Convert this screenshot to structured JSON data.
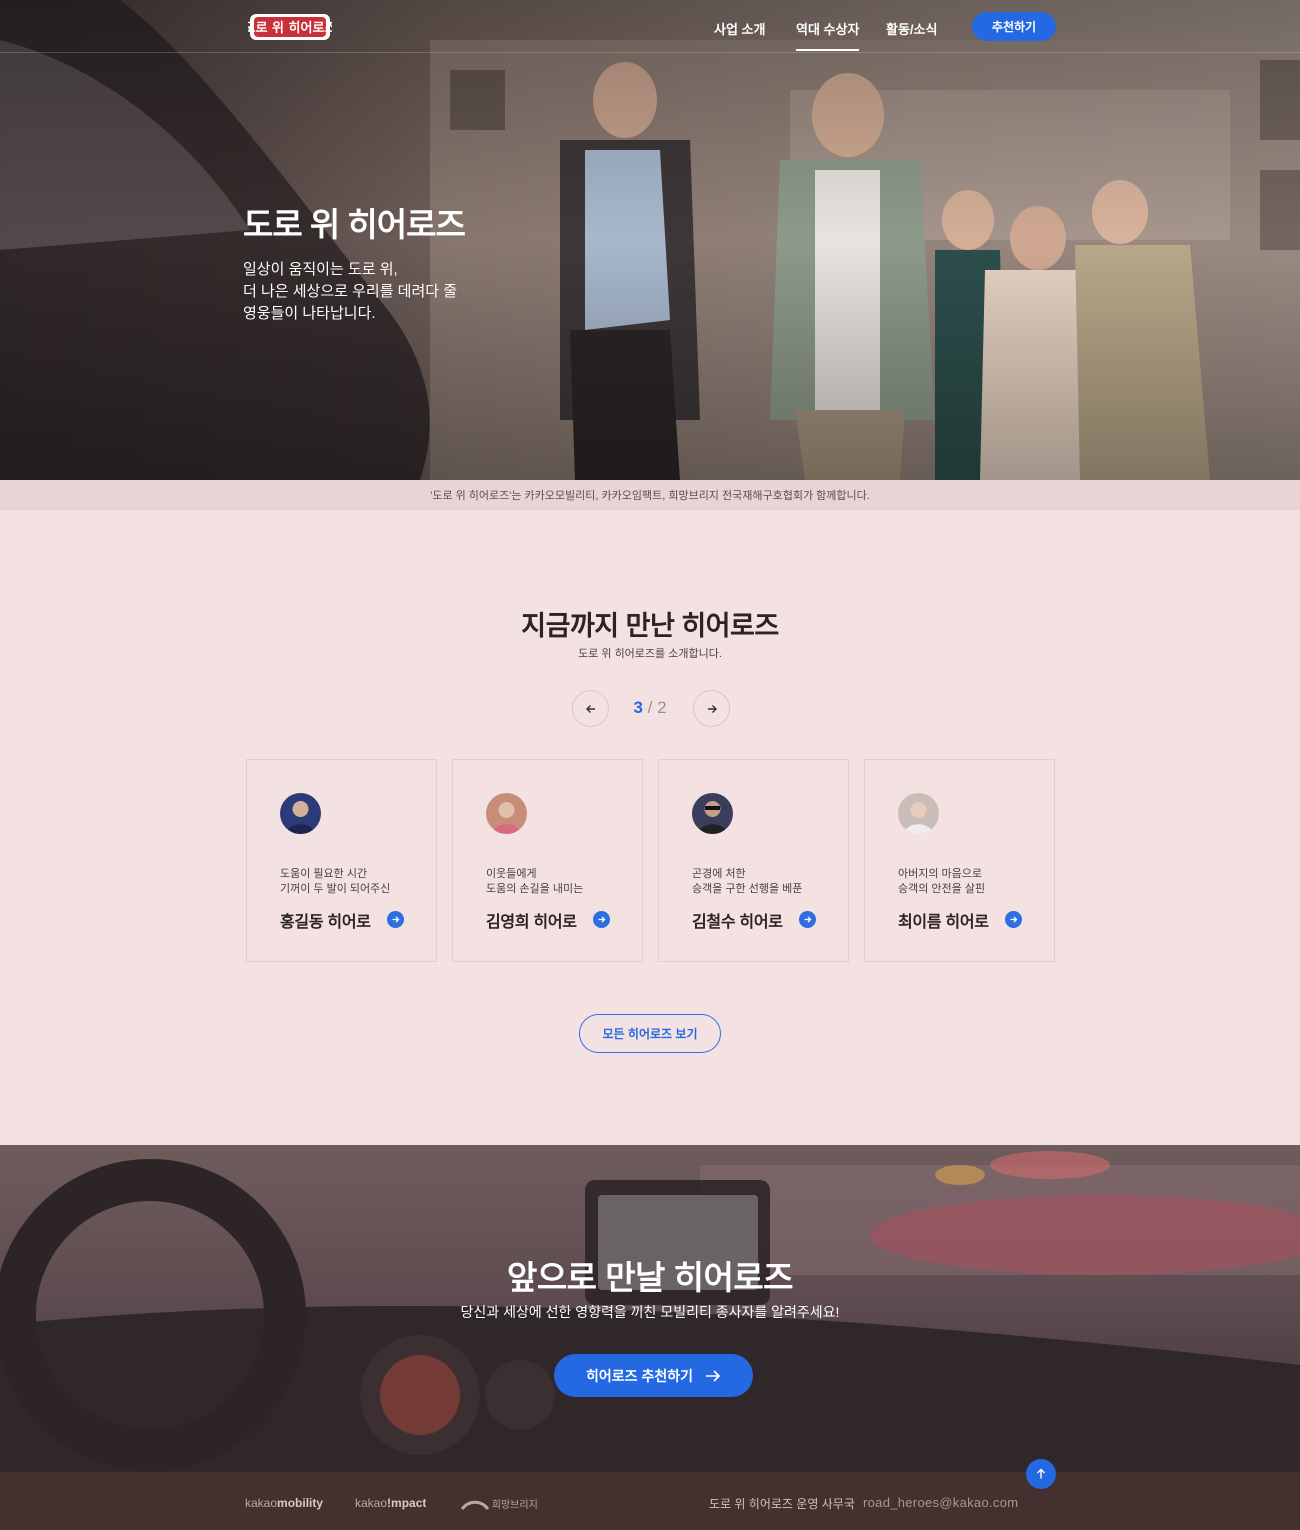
{
  "header": {
    "logo_text": "도로 위 히어로즈",
    "nav": [
      {
        "label": "사업 소개",
        "active": false
      },
      {
        "label": "역대 수상자",
        "active": true
      },
      {
        "label": "활동/소식",
        "active": false
      }
    ],
    "cta_label": "추천하기"
  },
  "hero": {
    "title": "도로 위 히어로즈",
    "desc_lines": [
      "일상이 움직이는 도로 위,",
      "더 나은 세상으로 우리를 데려다 줄",
      "영웅들이 나타납니다."
    ]
  },
  "partner_bar": "'도로 위 히어로즈'는 카카오모빌리티, 카카오임팩트, 희망브리지 전국재해구호협회가 함께합니다.",
  "heroes_section": {
    "title_plain": "지금까지 만난 ",
    "title_bold": "히어로즈",
    "subtitle": "도로 위 히어로즈를 소개합니다.",
    "pager": {
      "current": "3",
      "separator": " / ",
      "total": "2"
    },
    "cards": [
      {
        "desc": [
          "도움이 필요한 시간",
          "기꺼이 두 발이 되어주신"
        ],
        "name": "홍길동 히어로",
        "avatar_color": "#2b3b7a"
      },
      {
        "desc": [
          "이웃들에게",
          "도움의 손길을 내미는"
        ],
        "name": "김영희 히어로",
        "avatar_color": "#c78c7a"
      },
      {
        "desc": [
          "곤경에 처한",
          "승객을 구한 선행을 베푼"
        ],
        "name": "김철수 히어로",
        "avatar_color": "#3a3d5c"
      },
      {
        "desc": [
          "아버지의 마음으로",
          "승객의 안전을 살핀"
        ],
        "name": "최이름 히어로",
        "avatar_color": "#c9bdb8"
      }
    ],
    "all_button": "모든 히어로즈 보기"
  },
  "cta_section": {
    "title_plain": "앞으로 만날 ",
    "title_bold": "히어로즈",
    "subtitle": "당신과 세상에 선한 영향력을 끼친 모빌리티 종사자를 알려주세요!",
    "button": "히어로즈 추천하기"
  },
  "footer": {
    "logos": [
      {
        "light": "kakao",
        "bold": "mobility"
      },
      {
        "light": "kakao",
        "bold": "!mpact"
      },
      {
        "light": "희망브리지",
        "bold": ""
      }
    ],
    "office": "도로 위 히어로즈 운영 사무국",
    "email": "road_heroes@kakao.com"
  },
  "colors": {
    "accent": "#2469e2",
    "section_bg": "#f4e1e2",
    "footer_bg": "#43302f"
  },
  "icons": [
    "arrow-left-icon",
    "arrow-right-icon",
    "arrow-up-icon"
  ]
}
